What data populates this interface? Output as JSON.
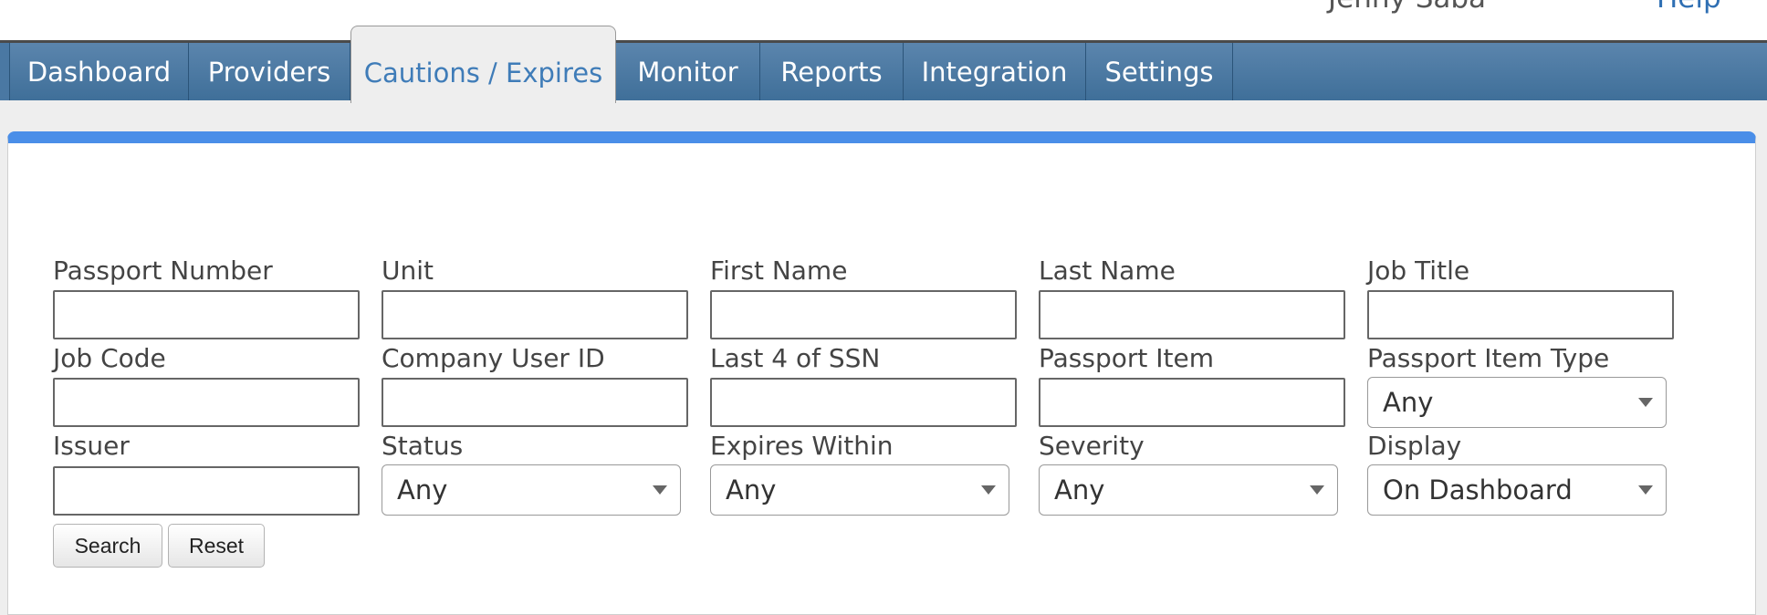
{
  "header": {
    "user_name": "Jenny Saba",
    "help_link": "Help"
  },
  "nav": {
    "tabs": [
      {
        "label": "Dashboard"
      },
      {
        "label": "Providers"
      },
      {
        "label": "Cautions / Expires",
        "active": true
      },
      {
        "label": "Monitor"
      },
      {
        "label": "Reports"
      },
      {
        "label": "Integration"
      },
      {
        "label": "Settings"
      }
    ]
  },
  "form": {
    "passport_number": {
      "label": "Passport Number",
      "value": ""
    },
    "unit": {
      "label": "Unit",
      "value": ""
    },
    "first_name": {
      "label": "First Name",
      "value": ""
    },
    "last_name": {
      "label": "Last Name",
      "value": ""
    },
    "job_title": {
      "label": "Job Title",
      "value": ""
    },
    "job_code": {
      "label": "Job Code",
      "value": ""
    },
    "company_user_id": {
      "label": "Company User ID",
      "value": ""
    },
    "last4_ssn": {
      "label": "Last 4 of SSN",
      "value": ""
    },
    "passport_item": {
      "label": "Passport Item",
      "value": ""
    },
    "passport_item_type": {
      "label": "Passport Item Type",
      "value": "Any"
    },
    "issuer": {
      "label": "Issuer",
      "value": ""
    },
    "status": {
      "label": "Status",
      "value": "Any"
    },
    "expires_within": {
      "label": "Expires Within",
      "value": "Any"
    },
    "severity": {
      "label": "Severity",
      "value": "Any"
    },
    "display": {
      "label": "Display",
      "value": "On Dashboard"
    }
  },
  "buttons": {
    "search_label": "Search",
    "reset_label": "Reset"
  },
  "colors": {
    "nav_bar": "#4a78a3",
    "panel_accent": "#4a8ee8",
    "active_tab_text": "#3f7cb8"
  }
}
